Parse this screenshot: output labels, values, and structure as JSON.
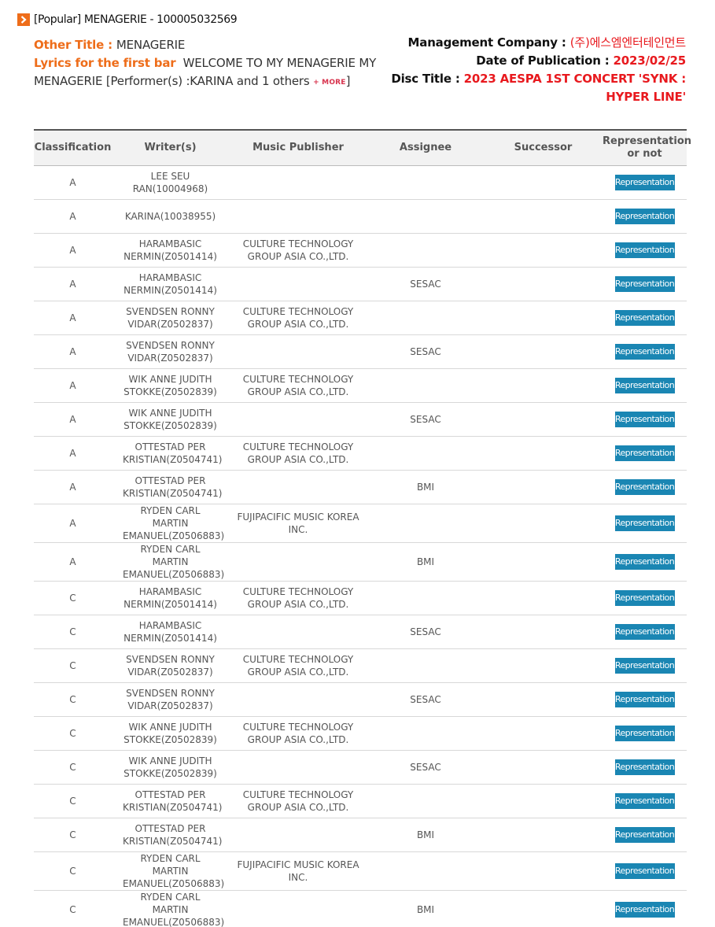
{
  "header": {
    "title": "[Popular] MENAGERIE - 100005032569",
    "arrow_icon": "chevron-right-icon"
  },
  "info": {
    "other_title_label": "Other Title : ",
    "other_title": "MENAGERIE",
    "lyrics_label": "Lyrics for the first bar",
    "lyrics": "WELCOME TO MY MENAGERIE MY MENAGERIE [Performer(s) :KARINA and 1 others",
    "more_label": "+ MORE",
    "lyrics_close": "]",
    "management_label": "Management Company : ",
    "management": "(주)에스엠엔터테인먼트",
    "date_label": "Date of Publication : ",
    "date": "2023/02/25",
    "disc_label": "Disc Title : ",
    "disc": "2023 AESPA 1ST CONCERT 'SYNK : HYPER LINE'"
  },
  "colors": {
    "accent": "#ee6d1a",
    "red": "#e8191e",
    "button": "#1a86b3"
  },
  "table": {
    "headers": {
      "classification": "Classification",
      "writers": "Writer(s)",
      "publisher": "Music Publisher",
      "assignee": "Assignee",
      "successor": "Successor",
      "representation": "Representation or not"
    },
    "rows": [
      {
        "classification": "A",
        "writer": "LEE SEU RAN(10004968)",
        "publisher": "",
        "assignee": "",
        "successor": "",
        "representation": "Representation"
      },
      {
        "classification": "A",
        "writer": "KARINA(10038955)",
        "publisher": "",
        "assignee": "",
        "successor": "",
        "representation": "Representation"
      },
      {
        "classification": "A",
        "writer": "HARAMBASIC NERMIN(Z0501414)",
        "publisher": "CULTURE TECHNOLOGY GROUP ASIA CO.,LTD.",
        "assignee": "",
        "successor": "",
        "representation": "Representation"
      },
      {
        "classification": "A",
        "writer": "HARAMBASIC NERMIN(Z0501414)",
        "publisher": "",
        "assignee": "SESAC",
        "successor": "",
        "representation": "Representation"
      },
      {
        "classification": "A",
        "writer": "SVENDSEN RONNY VIDAR(Z0502837)",
        "publisher": "CULTURE TECHNOLOGY GROUP ASIA CO.,LTD.",
        "assignee": "",
        "successor": "",
        "representation": "Representation"
      },
      {
        "classification": "A",
        "writer": "SVENDSEN RONNY VIDAR(Z0502837)",
        "publisher": "",
        "assignee": "SESAC",
        "successor": "",
        "representation": "Representation"
      },
      {
        "classification": "A",
        "writer": "WIK ANNE JUDITH STOKKE(Z0502839)",
        "publisher": "CULTURE TECHNOLOGY GROUP ASIA CO.,LTD.",
        "assignee": "",
        "successor": "",
        "representation": "Representation"
      },
      {
        "classification": "A",
        "writer": "WIK ANNE JUDITH STOKKE(Z0502839)",
        "publisher": "",
        "assignee": "SESAC",
        "successor": "",
        "representation": "Representation"
      },
      {
        "classification": "A",
        "writer": "OTTESTAD PER KRISTIAN(Z0504741)",
        "publisher": "CULTURE TECHNOLOGY GROUP ASIA CO.,LTD.",
        "assignee": "",
        "successor": "",
        "representation": "Representation"
      },
      {
        "classification": "A",
        "writer": "OTTESTAD PER KRISTIAN(Z0504741)",
        "publisher": "",
        "assignee": "BMI",
        "successor": "",
        "representation": "Representation"
      },
      {
        "classification": "A",
        "writer": "RYDEN CARL MARTIN EMANUEL(Z0506883)",
        "publisher": "FUJIPACIFIC MUSIC KOREA INC.",
        "assignee": "",
        "successor": "",
        "representation": "Representation"
      },
      {
        "classification": "A",
        "writer": "RYDEN CARL MARTIN EMANUEL(Z0506883)",
        "publisher": "",
        "assignee": "BMI",
        "successor": "",
        "representation": "Representation"
      },
      {
        "classification": "C",
        "writer": "HARAMBASIC NERMIN(Z0501414)",
        "publisher": "CULTURE TECHNOLOGY GROUP ASIA CO.,LTD.",
        "assignee": "",
        "successor": "",
        "representation": "Representation"
      },
      {
        "classification": "C",
        "writer": "HARAMBASIC NERMIN(Z0501414)",
        "publisher": "",
        "assignee": "SESAC",
        "successor": "",
        "representation": "Representation"
      },
      {
        "classification": "C",
        "writer": "SVENDSEN RONNY VIDAR(Z0502837)",
        "publisher": "CULTURE TECHNOLOGY GROUP ASIA CO.,LTD.",
        "assignee": "",
        "successor": "",
        "representation": "Representation"
      },
      {
        "classification": "C",
        "writer": "SVENDSEN RONNY VIDAR(Z0502837)",
        "publisher": "",
        "assignee": "SESAC",
        "successor": "",
        "representation": "Representation"
      },
      {
        "classification": "C",
        "writer": "WIK ANNE JUDITH STOKKE(Z0502839)",
        "publisher": "CULTURE TECHNOLOGY GROUP ASIA CO.,LTD.",
        "assignee": "",
        "successor": "",
        "representation": "Representation"
      },
      {
        "classification": "C",
        "writer": "WIK ANNE JUDITH STOKKE(Z0502839)",
        "publisher": "",
        "assignee": "SESAC",
        "successor": "",
        "representation": "Representation"
      },
      {
        "classification": "C",
        "writer": "OTTESTAD PER KRISTIAN(Z0504741)",
        "publisher": "CULTURE TECHNOLOGY GROUP ASIA CO.,LTD.",
        "assignee": "",
        "successor": "",
        "representation": "Representation"
      },
      {
        "classification": "C",
        "writer": "OTTESTAD PER KRISTIAN(Z0504741)",
        "publisher": "",
        "assignee": "BMI",
        "successor": "",
        "representation": "Representation"
      },
      {
        "classification": "C",
        "writer": "RYDEN CARL MARTIN EMANUEL(Z0506883)",
        "publisher": "FUJIPACIFIC MUSIC KOREA INC.",
        "assignee": "",
        "successor": "",
        "representation": "Representation"
      },
      {
        "classification": "C",
        "writer": "RYDEN CARL MARTIN EMANUEL(Z0506883)",
        "publisher": "",
        "assignee": "BMI",
        "successor": "",
        "representation": "Representation"
      }
    ]
  }
}
